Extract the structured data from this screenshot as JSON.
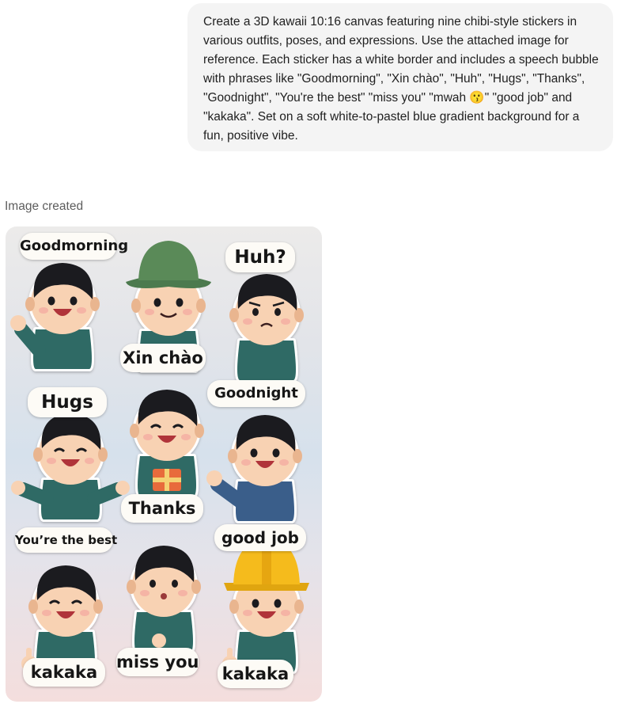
{
  "conversation": {
    "user_message": "Create a 3D kawaii 10:16 canvas featuring nine chibi-style stickers in various outfits, poses, and expressions. Use the attached image for reference. Each sticker has a white border and includes a speech bubble with phrases like \"Goodmorning\", \"Xin chào\", \"Huh\", \"Hugs\", \"Thanks\", \"Goodnight\", \"You're the best\" \"miss you\" \"mwah 😗\" \"good job\" and \"kakaka\". Set on a soft white-to-pastel blue gradient background for a fun, positive vibe.",
    "assistant_status": "Image created"
  },
  "image": {
    "background_colors": [
      "#ecebea",
      "#d6e1ec",
      "#f4dedd"
    ],
    "shirt_color": "#2f6a65",
    "stickers": [
      {
        "label": "Goodmorning",
        "pose": "waving",
        "accessory": "none"
      },
      {
        "label": "Xin chào",
        "pose": "smiling",
        "accessory": "green-bucket-hat"
      },
      {
        "label": "Huh?",
        "pose": "confused",
        "accessory": "none"
      },
      {
        "label": "Hugs",
        "pose": "open-arms",
        "accessory": "none"
      },
      {
        "label": "Thanks",
        "pose": "holding-gift",
        "accessory": "gift-box"
      },
      {
        "label": "Goodnight",
        "pose": "waving",
        "accessory": "blue-shirt"
      },
      {
        "label": "You’re the best",
        "pose": "thumbs-up",
        "accessory": "none"
      },
      {
        "label": "miss you",
        "pose": "kissing",
        "accessory": "none"
      },
      {
        "label": "good job",
        "pose": "thumbs-up",
        "accessory": "yellow-hard-hat"
      }
    ],
    "extra_labels": [
      "kakaka",
      "kakaka"
    ]
  }
}
